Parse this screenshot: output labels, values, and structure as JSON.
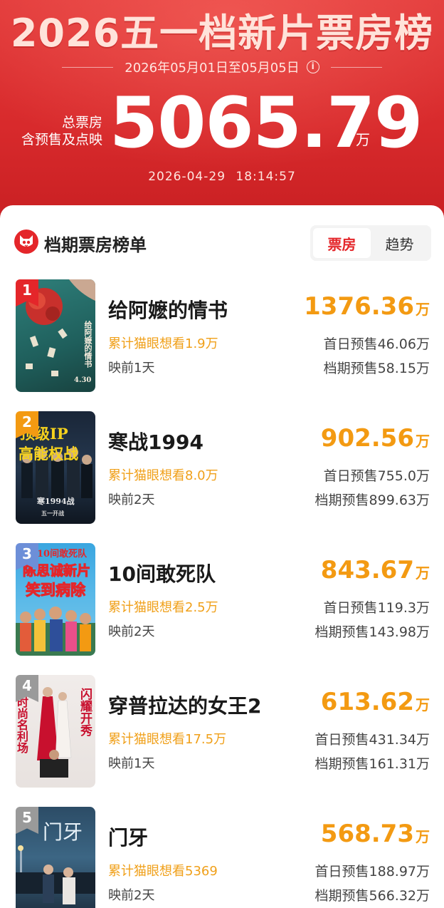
{
  "header": {
    "title": "2026五一档新片票房榜",
    "date_range": "2026年05月01日至05月05日",
    "total_label_1": "总票房",
    "total_label_2": "含预售及点映",
    "total_value": "5065.79",
    "total_unit": "万",
    "timestamp": "2026-04-29 18:14:57",
    "info_icon": "i"
  },
  "card": {
    "title": "档期票房榜单",
    "tabs": [
      {
        "label": "票房",
        "active": true
      },
      {
        "label": "趋势",
        "active": false
      }
    ]
  },
  "movies": [
    {
      "rank": "1",
      "name": "给阿嬷的情书",
      "gross": "1376.36",
      "unit": "万",
      "wish": "累计猫眼想看1.9万",
      "days": "映前1天",
      "first_day_presale": "首日预售46.06万",
      "period_presale": "档期预售58.15万",
      "badge_color": "#e4262a",
      "poster_text": [
        "给阿嬷的情书",
        "4.30"
      ]
    },
    {
      "rank": "2",
      "name": "寒战1994",
      "gross": "902.56",
      "unit": "万",
      "wish": "累计猫眼想看8.0万",
      "days": "映前2天",
      "first_day_presale": "首日预售755.0万",
      "period_presale": "档期预售899.63万",
      "badge_color": "#f39a12",
      "poster_text": [
        "顶级IP",
        "高能权战",
        "寒1994战",
        "五一开战"
      ]
    },
    {
      "rank": "3",
      "name": "10间敢死队",
      "gross": "843.67",
      "unit": "万",
      "wish": "累计猫眼想看2.5万",
      "days": "映前2天",
      "first_day_presale": "首日预售119.3万",
      "period_presale": "档期预售143.98万",
      "badge_color": "#6d8fd8",
      "poster_text": [
        "10间敢死队",
        "陈思诚新片",
        "笑到病除"
      ]
    },
    {
      "rank": "4",
      "name": "穿普拉达的女王2",
      "gross": "613.62",
      "unit": "万",
      "wish": "累计猫眼想看17.5万",
      "days": "映前1天",
      "first_day_presale": "首日预售431.34万",
      "period_presale": "档期预售161.31万",
      "badge_color": "#9a9a9a",
      "poster_text": [
        "闪耀开秀",
        "时尚名利场"
      ]
    },
    {
      "rank": "5",
      "name": "门牙",
      "gross": "568.73",
      "unit": "万",
      "wish": "累计猫眼想看5369",
      "days": "映前2天",
      "first_day_presale": "首日预售188.97万",
      "period_presale": "档期预售566.32万",
      "badge_color": "#9a9a9a",
      "poster_text": [
        "门牙"
      ]
    }
  ]
}
